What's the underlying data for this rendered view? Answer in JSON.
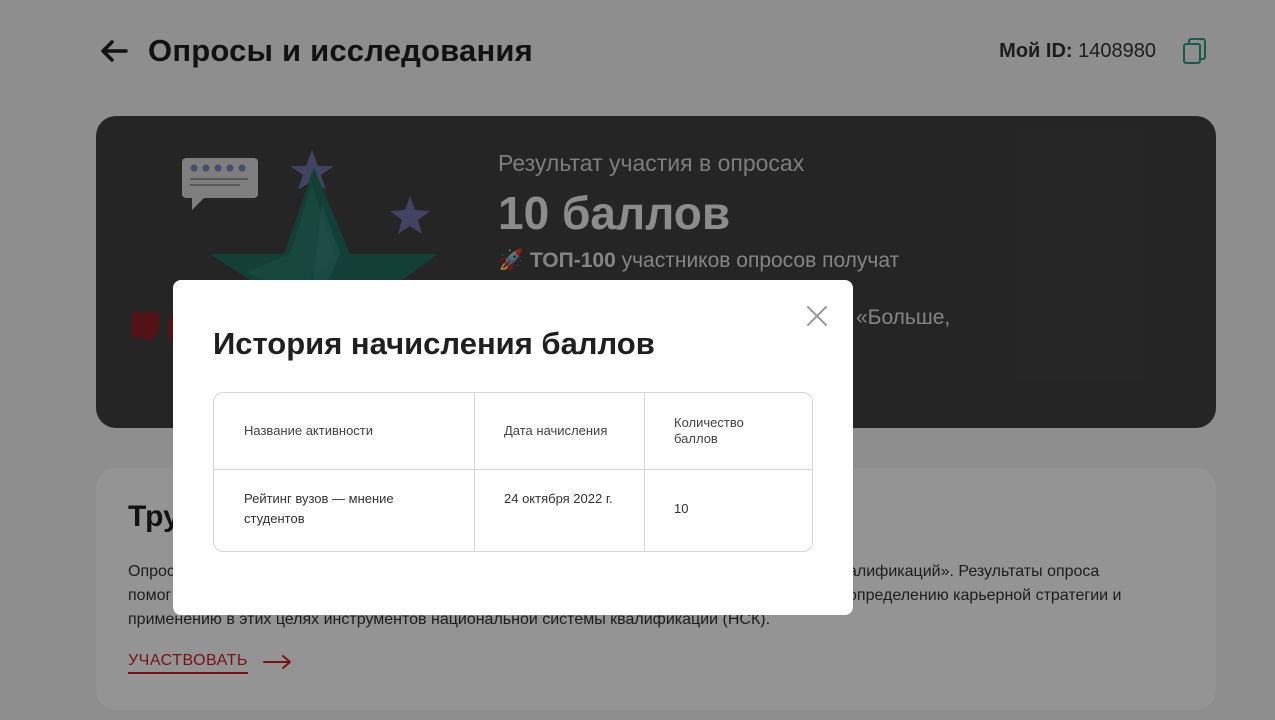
{
  "header": {
    "title": "Опросы и исследования",
    "my_id_label": "Мой ID:",
    "my_id_value": "1408980"
  },
  "hero": {
    "title": "Результат участия в опросах",
    "points": "10 баллов",
    "top_prefix": "🚀",
    "top_bold": "ТОП-100",
    "top_text": "участников опросов получат",
    "partial_text": "«Больше,"
  },
  "card": {
    "title": "Тру",
    "text_line1_start": "Опрос",
    "text_line1_end": "алификаций». Результаты опроса",
    "text_line2_start": "помог",
    "text_line2_end": "определению карьерной стратегии и",
    "text_line3": "применению в этих целях инструментов национальной системы квалификаций (НСК).",
    "link_label": "УЧАСТВОВАТЬ"
  },
  "modal": {
    "title": "История начисления баллов",
    "columns": [
      "Название активности",
      "Дата начисления",
      "Количество баллов"
    ],
    "rows": [
      {
        "activity": "Рейтинг вузов — мнение студентов",
        "date": "24 октября 2022 г.",
        "points": "10"
      }
    ]
  },
  "colors": {
    "accent_red": "#c8232c",
    "copy_icon": "#2e9c7c",
    "hero_bg": "#414141",
    "overlay": "rgba(0,0,0,0.42)"
  },
  "icons": [
    "arrow-left-icon",
    "copy-icon",
    "close-icon",
    "arrow-right-icon",
    "rocket-icon"
  ]
}
